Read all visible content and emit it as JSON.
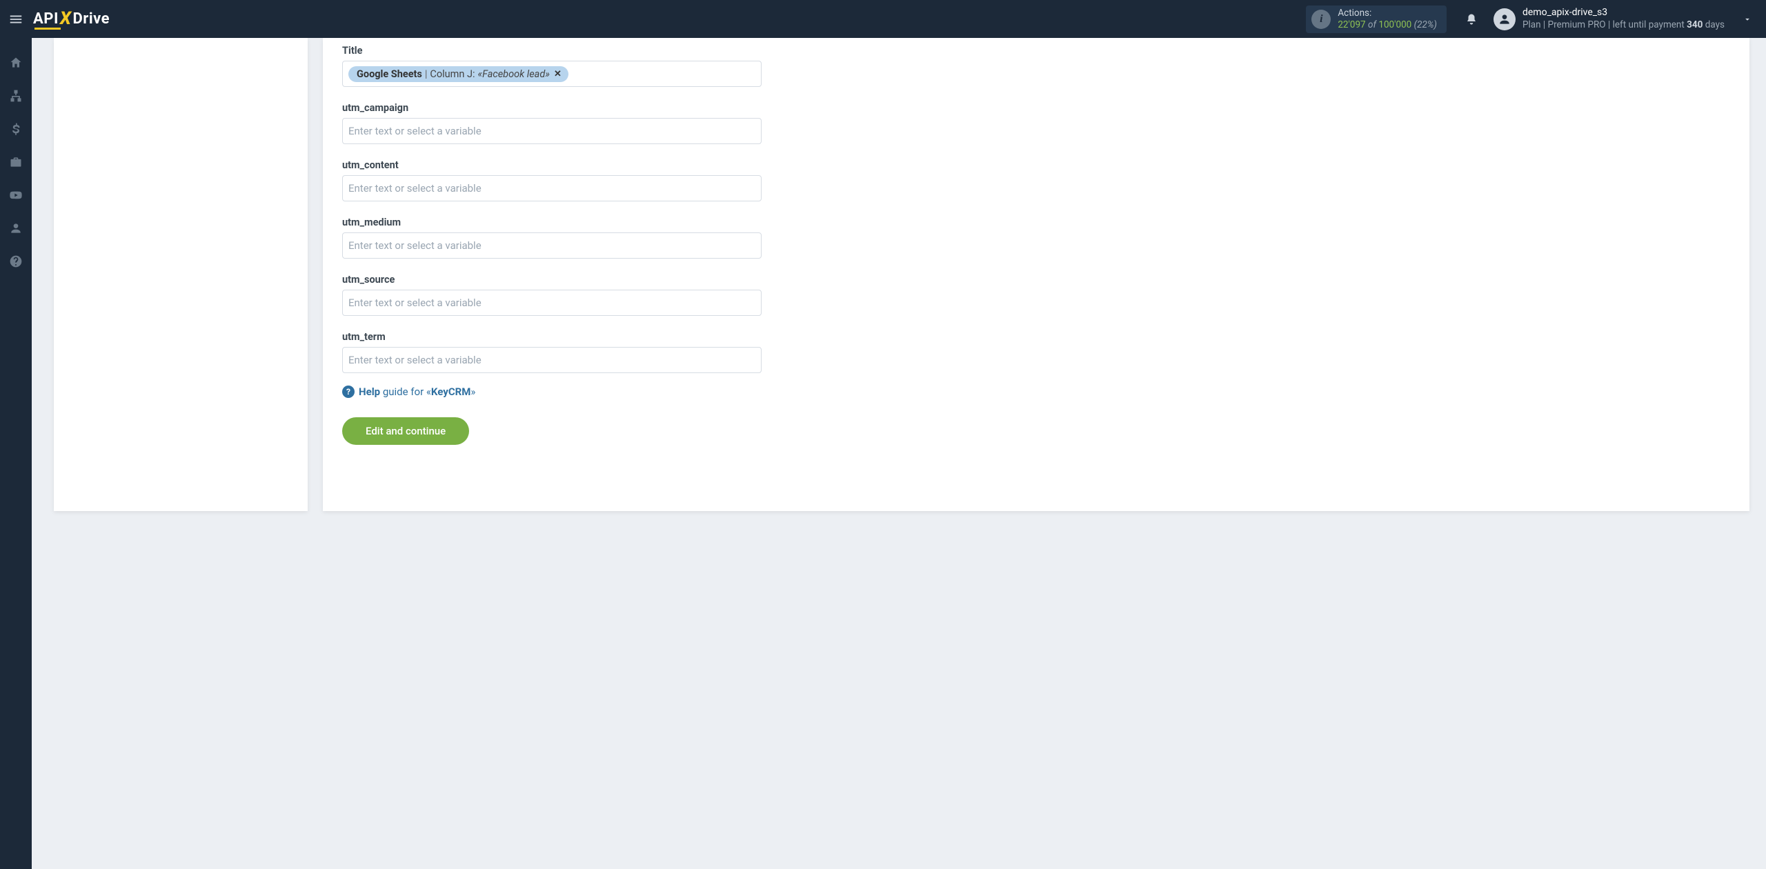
{
  "header": {
    "logo": {
      "part1": "API",
      "part2": "X",
      "part3": "Drive"
    },
    "actions": {
      "label": "Actions:",
      "used": "22'097",
      "of": "of",
      "total": "100'000",
      "pct": "(22%)"
    },
    "user": {
      "name": "demo_apix-drive_s3",
      "plan_prefix": "Plan |",
      "plan_name": "Premium PRO",
      "plan_suffix": "| left until payment",
      "days_count": "340",
      "days_word": "days"
    }
  },
  "sidebar": {
    "items": [
      {
        "name": "home"
      },
      {
        "name": "sitemap"
      },
      {
        "name": "dollar"
      },
      {
        "name": "briefcase"
      },
      {
        "name": "youtube"
      },
      {
        "name": "user"
      },
      {
        "name": "help"
      }
    ]
  },
  "form": {
    "placeholder": "Enter text or select a variable",
    "fields": [
      {
        "key": "title",
        "label": "Title",
        "chip": {
          "source": "Google Sheets",
          "separator": " | ",
          "column": "Column J:",
          "value_open": "«",
          "value": "Facebook lead",
          "value_close": "»"
        }
      },
      {
        "key": "utm_campaign",
        "label": "utm_campaign"
      },
      {
        "key": "utm_content",
        "label": "utm_content"
      },
      {
        "key": "utm_medium",
        "label": "utm_medium"
      },
      {
        "key": "utm_source",
        "label": "utm_source"
      },
      {
        "key": "utm_term",
        "label": "utm_term"
      }
    ],
    "help": {
      "bold": "Help",
      "mid": " guide for «",
      "target": "KeyCRM",
      "end": "»"
    },
    "button": "Edit and continue"
  }
}
